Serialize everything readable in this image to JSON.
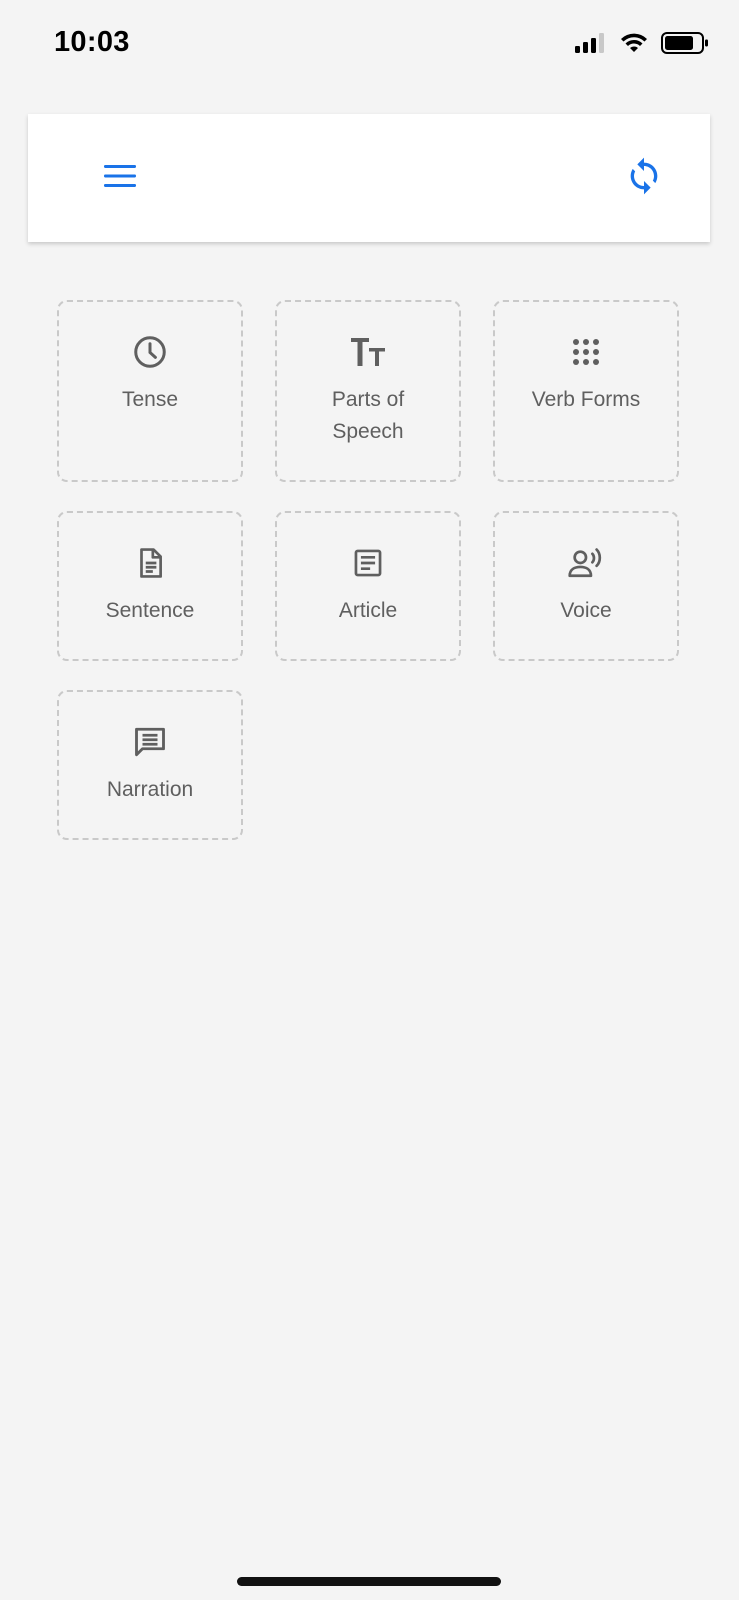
{
  "status_bar": {
    "time": "10:03",
    "icons": [
      "signal-icon",
      "wifi-icon",
      "battery-icon"
    ]
  },
  "header": {
    "menu_icon": "hamburger-menu-icon",
    "refresh_icon": "sync-icon",
    "accent_color": "#1a73e8"
  },
  "tiles": [
    {
      "label": "Tense",
      "icon": "clock-icon"
    },
    {
      "label": "Parts of Speech",
      "icon": "text-size-icon"
    },
    {
      "label": "Verb Forms",
      "icon": "apps-grid-icon"
    },
    {
      "label": "Sentence",
      "icon": "document-icon"
    },
    {
      "label": "Article",
      "icon": "article-icon"
    },
    {
      "label": "Voice",
      "icon": "record-voice-icon"
    },
    {
      "label": "Narration",
      "icon": "chat-message-icon"
    }
  ],
  "colors": {
    "background": "#f4f4f4",
    "tile_border": "#c9c9c9",
    "tile_text": "#5f5f5f",
    "icon_color": "#5f5f5f"
  }
}
